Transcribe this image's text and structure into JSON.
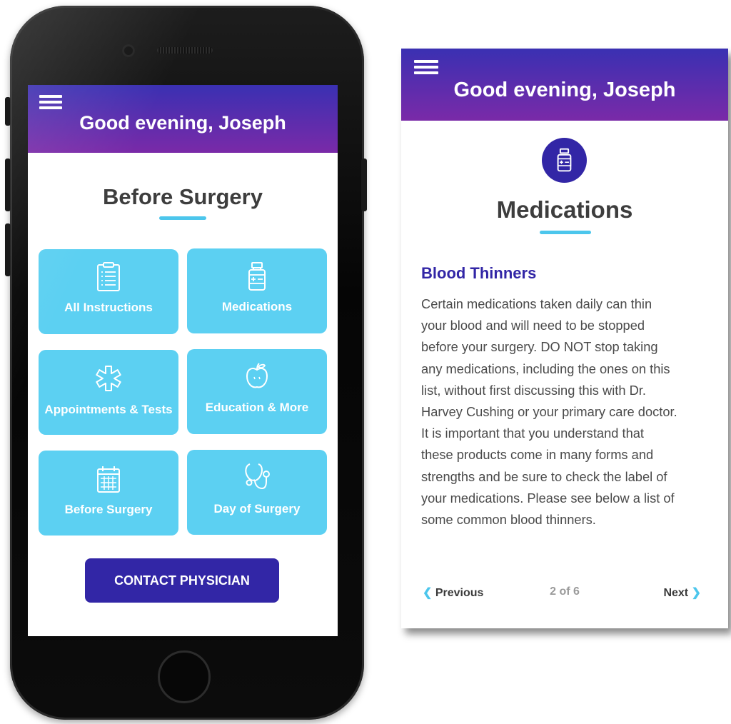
{
  "left_screen": {
    "header": {
      "greeting": "Good evening, Joseph"
    },
    "section_title": "Before Surgery",
    "tiles": [
      {
        "label": "All Instructions",
        "icon": "clipboard-icon"
      },
      {
        "label": "Medications",
        "icon": "pill-bottle-icon"
      },
      {
        "label": "Appointments & Tests",
        "icon": "medical-star-icon"
      },
      {
        "label": "Education & More",
        "icon": "apple-icon"
      },
      {
        "label": "Before Surgery",
        "icon": "calendar-icon"
      },
      {
        "label": "Day of Surgery",
        "icon": "stethoscope-icon"
      }
    ],
    "contact_button": "CONTACT PHYSICIAN"
  },
  "right_screen": {
    "header": {
      "greeting": "Good evening, Joseph"
    },
    "title": "Medications",
    "subheading": "Blood Thinners",
    "body_lines": [
      "Certain medications taken daily can thin",
      "your blood and will need to be stopped",
      "before your surgery. DO NOT stop taking",
      "any medications, including the ones on this",
      "list, without first discussing this with Dr.",
      "Harvey Cushing or your primary care doctor.",
      "It is important that you understand that",
      "these products come in many forms and",
      "strengths and be sure to check the label of",
      "your medications. Please see below a list of",
      "some common blood thinners."
    ],
    "pagination": {
      "previous": "Previous",
      "page": "2 of 6",
      "next": "Next"
    }
  },
  "colors": {
    "header_gradient_top": "#3a30b2",
    "header_gradient_bottom": "#7a2aa8",
    "tile": "#5cd0f2",
    "accent": "#4cc6ec",
    "primary_button": "#3226a6"
  }
}
